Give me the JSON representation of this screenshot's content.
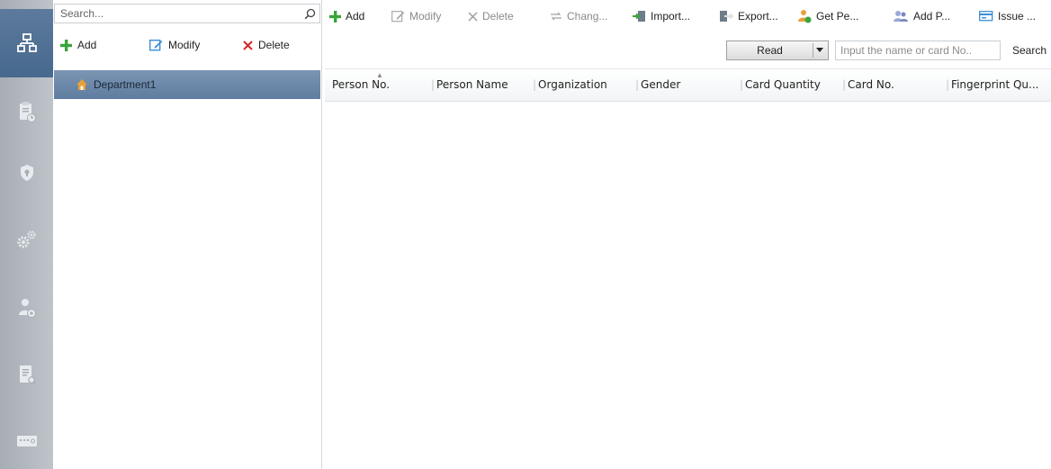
{
  "nav": {
    "items": [
      {
        "name": "organization-icon",
        "active": true
      },
      {
        "name": "clipboard-clock-icon",
        "active": false
      },
      {
        "name": "shield-icon",
        "active": false
      },
      {
        "name": "gears-icon",
        "active": false
      },
      {
        "name": "person-settings-icon",
        "active": false
      },
      {
        "name": "report-search-icon",
        "active": false
      },
      {
        "name": "keypad-device-icon",
        "active": false
      }
    ]
  },
  "left_panel": {
    "search_placeholder": "Search...",
    "toolbar": {
      "add_label": "Add",
      "modify_label": "Modify",
      "delete_label": "Delete"
    },
    "tree": {
      "department_label": "Department1"
    }
  },
  "toolbar": {
    "add_label": "Add",
    "modify_label": "Modify",
    "delete_label": "Delete",
    "change_label": "Chang...",
    "import_label": "Import...",
    "export_label": "Export...",
    "get_person_label": "Get Pe...",
    "add_person_label": "Add P...",
    "issue_label": "Issue ..."
  },
  "card_reader": {
    "read_label": "Read",
    "input_placeholder": "Input the name or card No..",
    "search_label": "Search"
  },
  "table": {
    "columns": [
      "Person No.",
      "Person Name",
      "Organization",
      "Gender",
      "Card Quantity",
      "Card No.",
      "Fingerprint Qu..."
    ],
    "rows": []
  },
  "colors": {
    "nav_bg": "#b3b8bf",
    "nav_active": "#5474978",
    "selected_row": "#6b88aa",
    "add_green": "#3aa53a",
    "delete_red": "#d7262b",
    "modify_blue": "#3d8fd8"
  }
}
